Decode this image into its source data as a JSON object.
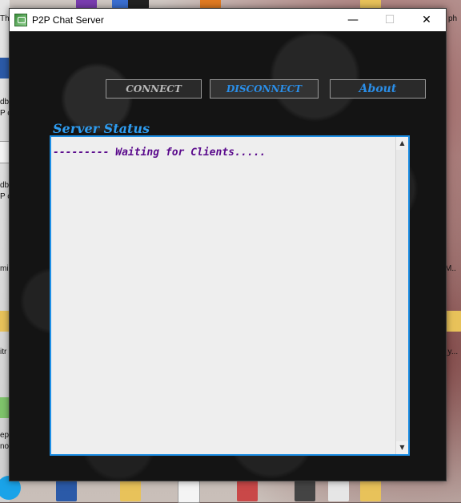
{
  "window": {
    "title": "P2P Chat Server",
    "minimize": "—",
    "maximize": "☐",
    "close": "✕"
  },
  "toolbar": {
    "connect_label": "CONNECT",
    "disconnect_label": "DISCONNECT",
    "about_label": "About"
  },
  "status": {
    "label": "Server Status",
    "log": "--------- Waiting for Clients....."
  },
  "scrollbar": {
    "up": "▲",
    "down": "▼"
  },
  "desktop": {
    "labels": [
      "Thi",
      "dbi",
      "P c",
      "dbi",
      "P c",
      "mi",
      "itr",
      "ep",
      "no",
      "ph",
      "M..",
      "_y..."
    ]
  },
  "colors": {
    "accent_blue": "#2e9cf0",
    "log_text": "#5a0a8c",
    "connect_text": "#b9b9b9"
  }
}
